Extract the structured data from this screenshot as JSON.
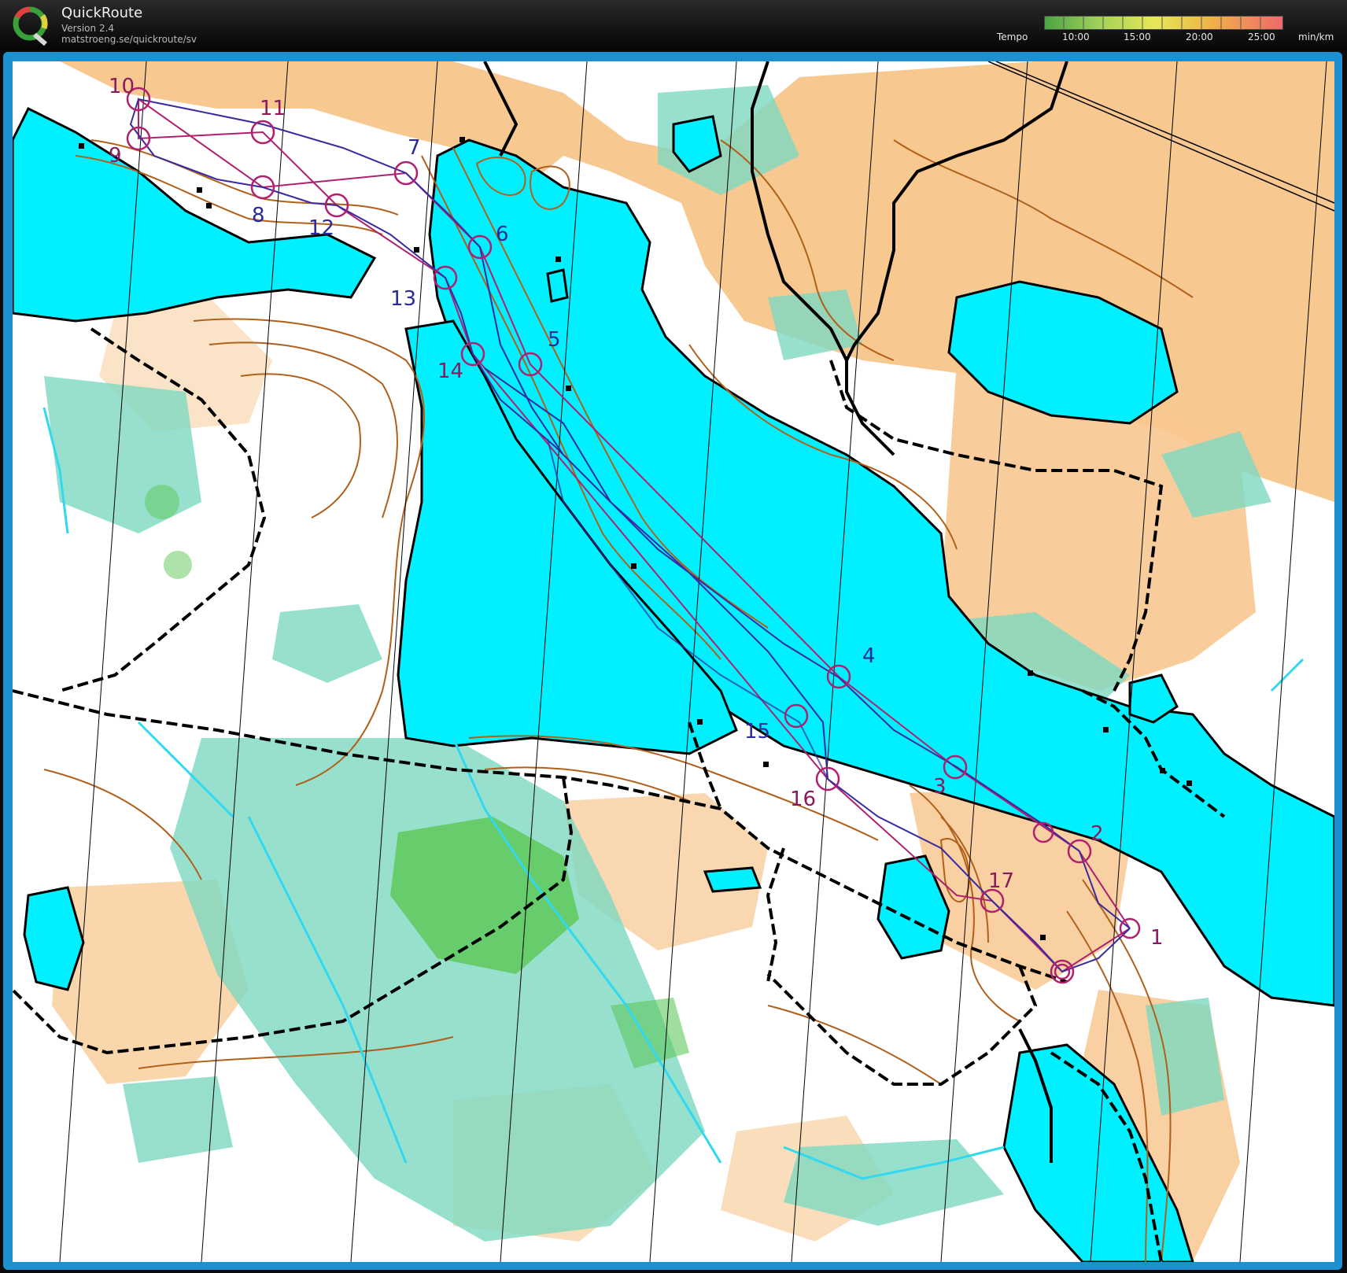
{
  "app": {
    "name": "QuickRoute",
    "version": "Version 2.4",
    "url": "matstroeng.se/quickroute/sv",
    "logo_letter": "Q"
  },
  "tempo": {
    "label": "Tempo",
    "unit": "min/km",
    "ticks": [
      "10:00",
      "15:00",
      "20:00",
      "25:00"
    ]
  },
  "colors": {
    "water": "#00f0ff",
    "open_land": "#f7c890",
    "green_marsh": "#7dd8c0",
    "forest_green": "#5ec85a",
    "contour": "#b0601a",
    "course": "#b0206e",
    "route": "#3a2aa0",
    "path": "#000000"
  },
  "controls": [
    {
      "label": "1"
    },
    {
      "label": "2"
    },
    {
      "label": "3"
    },
    {
      "label": "4"
    },
    {
      "label": "5"
    },
    {
      "label": "6"
    },
    {
      "label": "7"
    },
    {
      "label": "8"
    },
    {
      "label": "9"
    },
    {
      "label": "10"
    },
    {
      "label": "11"
    },
    {
      "label": "12"
    },
    {
      "label": "13"
    },
    {
      "label": "14"
    },
    {
      "label": "15"
    },
    {
      "label": "16"
    },
    {
      "label": "17"
    }
  ]
}
